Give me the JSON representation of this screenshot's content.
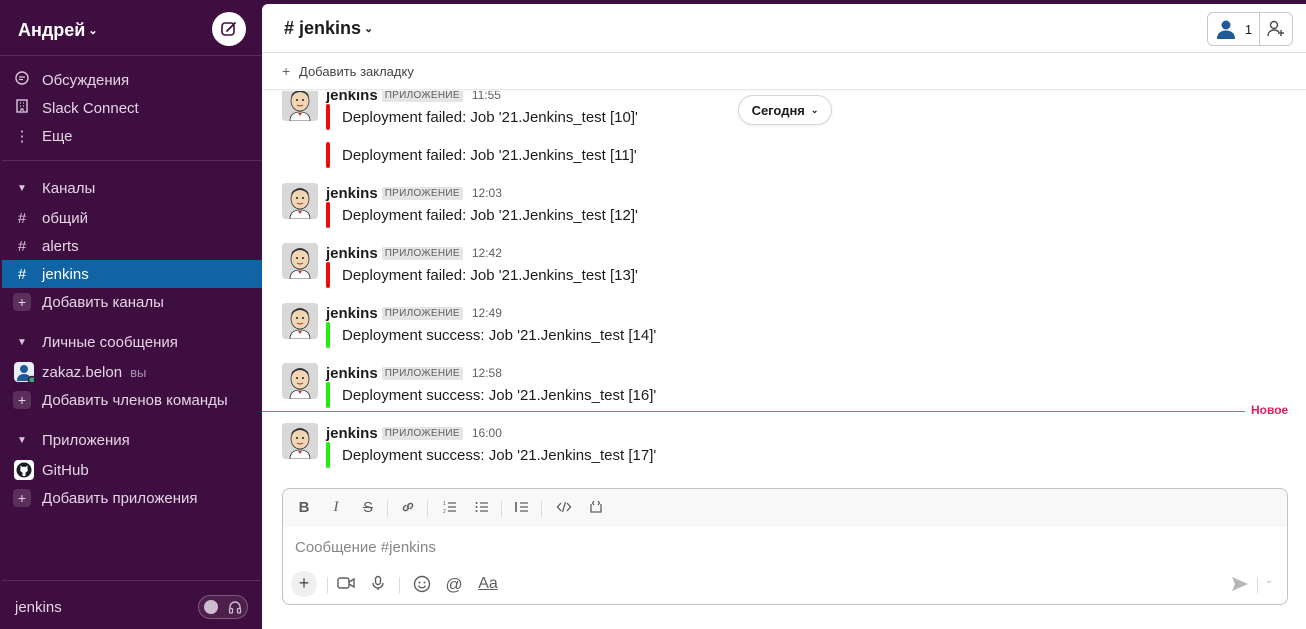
{
  "workspace": {
    "name": "Андрей"
  },
  "sidebar": {
    "top_items": [
      {
        "label": "Обсуждения",
        "icon": "threads-icon"
      },
      {
        "label": "Slack Connect",
        "icon": "building-icon"
      },
      {
        "label": "Еще",
        "icon": "more-vertical-icon"
      }
    ],
    "channels_section": "Каналы",
    "channels": [
      {
        "label": "общий",
        "active": false
      },
      {
        "label": "alerts",
        "active": false
      },
      {
        "label": "jenkins",
        "active": true
      }
    ],
    "add_channels": "Добавить каналы",
    "dm_section": "Личные сообщения",
    "dm_user": {
      "name": "zakaz.belon",
      "suffix": "вы"
    },
    "add_members": "Добавить членов команды",
    "apps_section": "Приложения",
    "apps": [
      {
        "label": "GitHub",
        "icon": "github-icon"
      }
    ],
    "add_apps": "Добавить приложения",
    "footer_name": "jenkins"
  },
  "channel": {
    "name": "# jenkins",
    "member_count": "1",
    "bookmark_label": "Добавить закладку",
    "today_label": "Сегодня",
    "new_label": "Новое"
  },
  "messages": [
    {
      "user": "jenkins",
      "badge": "ПРИЛОЖЕНИЕ",
      "time": "11:55",
      "lines": [
        {
          "text": "Deployment failed: Job '21.Jenkins_test [10]'",
          "status": "red"
        },
        {
          "text": "Deployment failed: Job '21.Jenkins_test [11]'",
          "status": "red"
        }
      ]
    },
    {
      "user": "jenkins",
      "badge": "ПРИЛОЖЕНИЕ",
      "time": "12:03",
      "lines": [
        {
          "text": "Deployment failed: Job '21.Jenkins_test [12]'",
          "status": "red"
        }
      ]
    },
    {
      "user": "jenkins",
      "badge": "ПРИЛОЖЕНИЕ",
      "time": "12:42",
      "lines": [
        {
          "text": "Deployment failed: Job '21.Jenkins_test [13]'",
          "status": "red"
        }
      ]
    },
    {
      "user": "jenkins",
      "badge": "ПРИЛОЖЕНИЕ",
      "time": "12:49",
      "lines": [
        {
          "text": "Deployment success: Job '21.Jenkins_test [14]'",
          "status": "green"
        }
      ]
    },
    {
      "user": "jenkins",
      "badge": "ПРИЛОЖЕНИЕ",
      "time": "12:58",
      "lines": [
        {
          "text": "Deployment success: Job '21.Jenkins_test [16]'",
          "status": "green"
        }
      ]
    },
    {
      "user": "jenkins",
      "badge": "ПРИЛОЖЕНИЕ",
      "time": "16:00",
      "lines": [
        {
          "text": "Deployment success: Job '21.Jenkins_test [17]'",
          "status": "green"
        }
      ]
    }
  ],
  "composer": {
    "placeholder": "Сообщение #jenkins",
    "format_label": "Aa"
  },
  "colors": {
    "sidebar_bg": "#3f0e40",
    "active_item": "#1164a3",
    "failed": "#ee0a0a",
    "success": "#20ee0f",
    "new_divider": "#e01e5a"
  }
}
